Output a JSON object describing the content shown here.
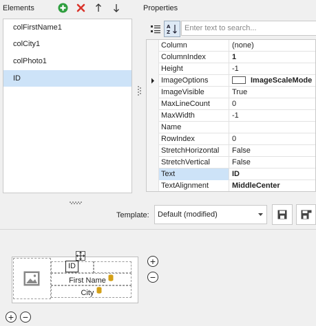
{
  "elements": {
    "title": "Elements",
    "toolbar": {
      "add_icon": "add-icon",
      "remove_icon": "remove-icon",
      "up_icon": "arrow-up-icon",
      "down_icon": "arrow-down-icon"
    },
    "items": [
      "colFirstName1",
      "colCity1",
      "colPhoto1",
      "ID"
    ],
    "selected_index": 3
  },
  "properties": {
    "title": "Properties",
    "search_placeholder": "Enter text to search...",
    "rows": [
      {
        "name": "Column",
        "value": "(none)"
      },
      {
        "name": "ColumnIndex",
        "value": "1"
      },
      {
        "name": "Height",
        "value": "-1"
      },
      {
        "name": "ImageOptions",
        "value": "ImageScaleMode"
      },
      {
        "name": "ImageVisible",
        "value": "True"
      },
      {
        "name": "MaxLineCount",
        "value": "0"
      },
      {
        "name": "MaxWidth",
        "value": "-1"
      },
      {
        "name": "Name",
        "value": ""
      },
      {
        "name": "RowIndex",
        "value": "0"
      },
      {
        "name": "StretchHorizontal",
        "value": "False"
      },
      {
        "name": "StretchVertical",
        "value": "False"
      },
      {
        "name": "Text",
        "value": "ID"
      },
      {
        "name": "TextAlignment",
        "value": "MiddleCenter"
      }
    ]
  },
  "template": {
    "label": "Template:",
    "value": "Default (modified)"
  },
  "designer": {
    "id_label": "ID",
    "first_name_label": "First Name",
    "city_label": "City",
    "plus": "+",
    "minus": "−"
  },
  "colors": {
    "accent_select": "#cde3f8",
    "add_green": "#2e9e3e",
    "remove_red": "#d9342b"
  }
}
